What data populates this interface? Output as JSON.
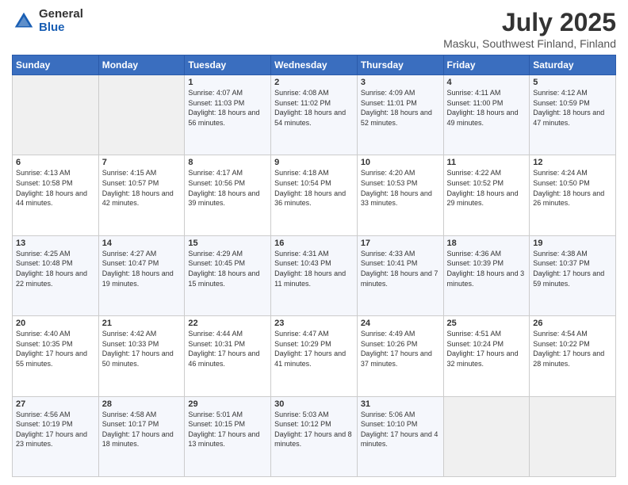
{
  "header": {
    "logo_general": "General",
    "logo_blue": "Blue",
    "title": "July 2025",
    "subtitle": "Masku, Southwest Finland, Finland"
  },
  "weekdays": [
    "Sunday",
    "Monday",
    "Tuesday",
    "Wednesday",
    "Thursday",
    "Friday",
    "Saturday"
  ],
  "weeks": [
    [
      {
        "day": "",
        "sunrise": "",
        "sunset": "",
        "daylight": ""
      },
      {
        "day": "",
        "sunrise": "",
        "sunset": "",
        "daylight": ""
      },
      {
        "day": "1",
        "sunrise": "Sunrise: 4:07 AM",
        "sunset": "Sunset: 11:03 PM",
        "daylight": "Daylight: 18 hours and 56 minutes."
      },
      {
        "day": "2",
        "sunrise": "Sunrise: 4:08 AM",
        "sunset": "Sunset: 11:02 PM",
        "daylight": "Daylight: 18 hours and 54 minutes."
      },
      {
        "day": "3",
        "sunrise": "Sunrise: 4:09 AM",
        "sunset": "Sunset: 11:01 PM",
        "daylight": "Daylight: 18 hours and 52 minutes."
      },
      {
        "day": "4",
        "sunrise": "Sunrise: 4:11 AM",
        "sunset": "Sunset: 11:00 PM",
        "daylight": "Daylight: 18 hours and 49 minutes."
      },
      {
        "day": "5",
        "sunrise": "Sunrise: 4:12 AM",
        "sunset": "Sunset: 10:59 PM",
        "daylight": "Daylight: 18 hours and 47 minutes."
      }
    ],
    [
      {
        "day": "6",
        "sunrise": "Sunrise: 4:13 AM",
        "sunset": "Sunset: 10:58 PM",
        "daylight": "Daylight: 18 hours and 44 minutes."
      },
      {
        "day": "7",
        "sunrise": "Sunrise: 4:15 AM",
        "sunset": "Sunset: 10:57 PM",
        "daylight": "Daylight: 18 hours and 42 minutes."
      },
      {
        "day": "8",
        "sunrise": "Sunrise: 4:17 AM",
        "sunset": "Sunset: 10:56 PM",
        "daylight": "Daylight: 18 hours and 39 minutes."
      },
      {
        "day": "9",
        "sunrise": "Sunrise: 4:18 AM",
        "sunset": "Sunset: 10:54 PM",
        "daylight": "Daylight: 18 hours and 36 minutes."
      },
      {
        "day": "10",
        "sunrise": "Sunrise: 4:20 AM",
        "sunset": "Sunset: 10:53 PM",
        "daylight": "Daylight: 18 hours and 33 minutes."
      },
      {
        "day": "11",
        "sunrise": "Sunrise: 4:22 AM",
        "sunset": "Sunset: 10:52 PM",
        "daylight": "Daylight: 18 hours and 29 minutes."
      },
      {
        "day": "12",
        "sunrise": "Sunrise: 4:24 AM",
        "sunset": "Sunset: 10:50 PM",
        "daylight": "Daylight: 18 hours and 26 minutes."
      }
    ],
    [
      {
        "day": "13",
        "sunrise": "Sunrise: 4:25 AM",
        "sunset": "Sunset: 10:48 PM",
        "daylight": "Daylight: 18 hours and 22 minutes."
      },
      {
        "day": "14",
        "sunrise": "Sunrise: 4:27 AM",
        "sunset": "Sunset: 10:47 PM",
        "daylight": "Daylight: 18 hours and 19 minutes."
      },
      {
        "day": "15",
        "sunrise": "Sunrise: 4:29 AM",
        "sunset": "Sunset: 10:45 PM",
        "daylight": "Daylight: 18 hours and 15 minutes."
      },
      {
        "day": "16",
        "sunrise": "Sunrise: 4:31 AM",
        "sunset": "Sunset: 10:43 PM",
        "daylight": "Daylight: 18 hours and 11 minutes."
      },
      {
        "day": "17",
        "sunrise": "Sunrise: 4:33 AM",
        "sunset": "Sunset: 10:41 PM",
        "daylight": "Daylight: 18 hours and 7 minutes."
      },
      {
        "day": "18",
        "sunrise": "Sunrise: 4:36 AM",
        "sunset": "Sunset: 10:39 PM",
        "daylight": "Daylight: 18 hours and 3 minutes."
      },
      {
        "day": "19",
        "sunrise": "Sunrise: 4:38 AM",
        "sunset": "Sunset: 10:37 PM",
        "daylight": "Daylight: 17 hours and 59 minutes."
      }
    ],
    [
      {
        "day": "20",
        "sunrise": "Sunrise: 4:40 AM",
        "sunset": "Sunset: 10:35 PM",
        "daylight": "Daylight: 17 hours and 55 minutes."
      },
      {
        "day": "21",
        "sunrise": "Sunrise: 4:42 AM",
        "sunset": "Sunset: 10:33 PM",
        "daylight": "Daylight: 17 hours and 50 minutes."
      },
      {
        "day": "22",
        "sunrise": "Sunrise: 4:44 AM",
        "sunset": "Sunset: 10:31 PM",
        "daylight": "Daylight: 17 hours and 46 minutes."
      },
      {
        "day": "23",
        "sunrise": "Sunrise: 4:47 AM",
        "sunset": "Sunset: 10:29 PM",
        "daylight": "Daylight: 17 hours and 41 minutes."
      },
      {
        "day": "24",
        "sunrise": "Sunrise: 4:49 AM",
        "sunset": "Sunset: 10:26 PM",
        "daylight": "Daylight: 17 hours and 37 minutes."
      },
      {
        "day": "25",
        "sunrise": "Sunrise: 4:51 AM",
        "sunset": "Sunset: 10:24 PM",
        "daylight": "Daylight: 17 hours and 32 minutes."
      },
      {
        "day": "26",
        "sunrise": "Sunrise: 4:54 AM",
        "sunset": "Sunset: 10:22 PM",
        "daylight": "Daylight: 17 hours and 28 minutes."
      }
    ],
    [
      {
        "day": "27",
        "sunrise": "Sunrise: 4:56 AM",
        "sunset": "Sunset: 10:19 PM",
        "daylight": "Daylight: 17 hours and 23 minutes."
      },
      {
        "day": "28",
        "sunrise": "Sunrise: 4:58 AM",
        "sunset": "Sunset: 10:17 PM",
        "daylight": "Daylight: 17 hours and 18 minutes."
      },
      {
        "day": "29",
        "sunrise": "Sunrise: 5:01 AM",
        "sunset": "Sunset: 10:15 PM",
        "daylight": "Daylight: 17 hours and 13 minutes."
      },
      {
        "day": "30",
        "sunrise": "Sunrise: 5:03 AM",
        "sunset": "Sunset: 10:12 PM",
        "daylight": "Daylight: 17 hours and 8 minutes."
      },
      {
        "day": "31",
        "sunrise": "Sunrise: 5:06 AM",
        "sunset": "Sunset: 10:10 PM",
        "daylight": "Daylight: 17 hours and 4 minutes."
      },
      {
        "day": "",
        "sunrise": "",
        "sunset": "",
        "daylight": ""
      },
      {
        "day": "",
        "sunrise": "",
        "sunset": "",
        "daylight": ""
      }
    ]
  ]
}
